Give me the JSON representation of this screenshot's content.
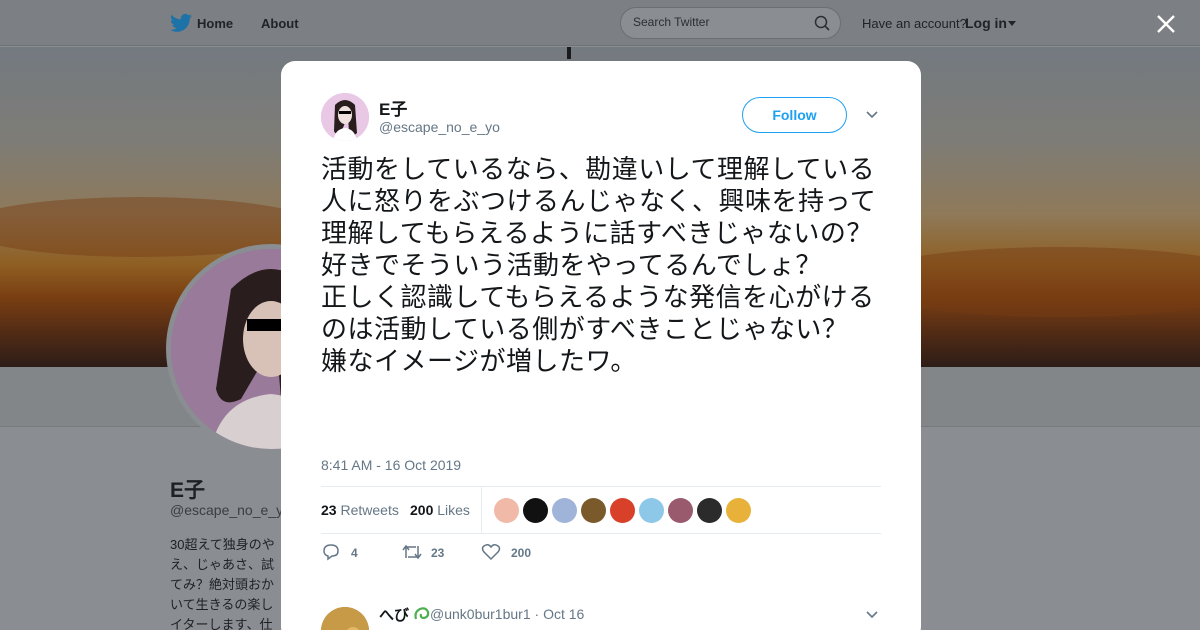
{
  "topbar": {
    "home_label": "Home",
    "about_label": "About",
    "search_placeholder": "Search Twitter",
    "have_account_text": "Have an account?",
    "login_label": "Log in"
  },
  "background_profile": {
    "name": "E子",
    "handle": "@escape_no_e_y",
    "bio_fragment": "30超えて独身のや\nえ、じゃあさ、試\nてみ？絶対頭おか\nいて生きるの楽し\nイターします、仕"
  },
  "tweet": {
    "author_name": "E子",
    "author_handle": "@escape_no_e_yo",
    "follow_label": "Follow",
    "text": "活動をしているなら、勘違いして理解している人に怒りをぶつけるんじゃなく、興味を持って理解してもらえるように話すべきじゃないの？\n好きでそういう活動をやってるんでしょ？\n正しく認識してもらえるような発信を心がけるのは活動している側がすべきことじゃない？\n嫌なイメージが増したワ。",
    "timestamp": "8:41 AM - 16 Oct 2019",
    "retweets_count": "23",
    "retweets_label": "Retweets",
    "likes_count": "200",
    "likes_label": "Likes",
    "reply_action_count": "4",
    "retweet_action_count": "23",
    "like_action_count": "200"
  },
  "likers": [
    {
      "icon": "liker-avatar-1",
      "color": "#f0b9a8"
    },
    {
      "icon": "liker-avatar-2",
      "color": "#111111"
    },
    {
      "icon": "liker-avatar-3",
      "color": "#9fb4d8"
    },
    {
      "icon": "liker-avatar-4",
      "color": "#7a5a2a"
    },
    {
      "icon": "liker-avatar-5",
      "color": "#d8402a"
    },
    {
      "icon": "liker-avatar-6",
      "color": "#8ec8e8"
    },
    {
      "icon": "liker-avatar-7",
      "color": "#9a5a6e"
    },
    {
      "icon": "liker-avatar-8",
      "color": "#2b2b2b"
    },
    {
      "icon": "liker-avatar-9",
      "color": "#e8b23a"
    }
  ],
  "reply": {
    "author_name": "へび",
    "author_handle": "@unk0bur1bur1",
    "date": "· Oct 16"
  },
  "colors": {
    "accent": "#1da1f2",
    "secondary_text": "#657786"
  }
}
